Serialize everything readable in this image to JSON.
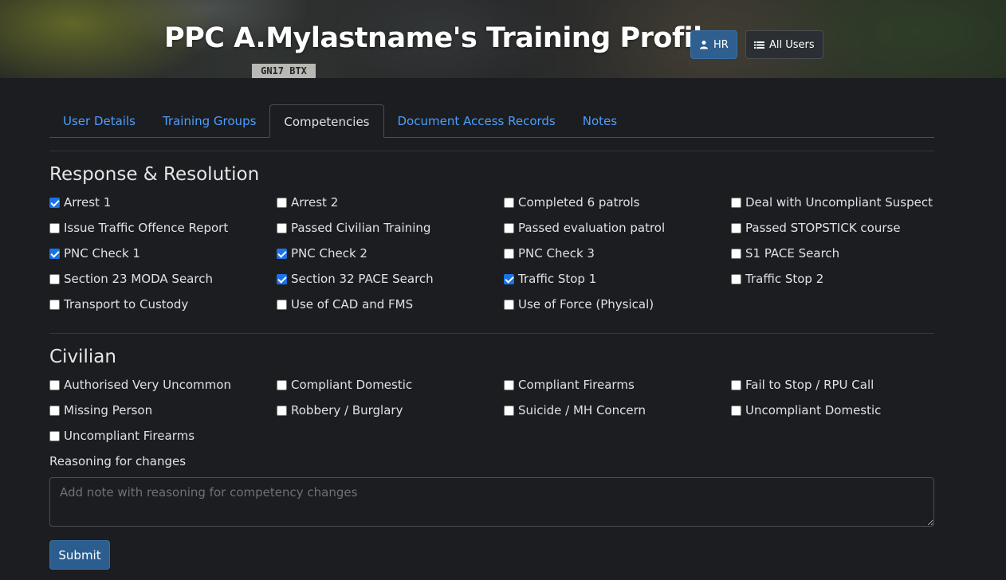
{
  "header": {
    "title": "PPC A.Mylastname's Training Profile",
    "plate_text": "GN17 BTX",
    "hr_label": "HR",
    "users_label": "All Users"
  },
  "tabs": [
    {
      "label": "User Details",
      "active": false
    },
    {
      "label": "Training Groups",
      "active": false
    },
    {
      "label": "Competencies",
      "active": true
    },
    {
      "label": "Document Access Records",
      "active": false
    },
    {
      "label": "Notes",
      "active": false
    }
  ],
  "sections": [
    {
      "title": "Response & Resolution",
      "items": [
        {
          "label": "Arrest 1",
          "checked": true
        },
        {
          "label": "Arrest 2",
          "checked": false
        },
        {
          "label": "Completed 6 patrols",
          "checked": false
        },
        {
          "label": "Deal with Uncompliant Suspect",
          "checked": false
        },
        {
          "label": "Issue Traffic Offence Report",
          "checked": false
        },
        {
          "label": "Passed Civilian Training",
          "checked": false
        },
        {
          "label": "Passed evaluation patrol",
          "checked": false
        },
        {
          "label": "Passed STOPSTICK course",
          "checked": false
        },
        {
          "label": "PNC Check 1",
          "checked": true
        },
        {
          "label": "PNC Check 2",
          "checked": true
        },
        {
          "label": "PNC Check 3",
          "checked": false
        },
        {
          "label": "S1 PACE Search",
          "checked": false
        },
        {
          "label": "Section 23 MODA Search",
          "checked": false
        },
        {
          "label": "Section 32 PACE Search",
          "checked": true
        },
        {
          "label": "Traffic Stop 1",
          "checked": true
        },
        {
          "label": "Traffic Stop 2",
          "checked": false
        },
        {
          "label": "Transport to Custody",
          "checked": false
        },
        {
          "label": "Use of CAD and FMS",
          "checked": false
        },
        {
          "label": "Use of Force (Physical)",
          "checked": false
        }
      ]
    },
    {
      "title": "Civilian",
      "items": [
        {
          "label": "Authorised Very Uncommon",
          "checked": false
        },
        {
          "label": "Compliant Domestic",
          "checked": false
        },
        {
          "label": "Compliant Firearms",
          "checked": false
        },
        {
          "label": "Fail to Stop / RPU Call",
          "checked": false
        },
        {
          "label": "Missing Person",
          "checked": false
        },
        {
          "label": "Robbery / Burglary",
          "checked": false
        },
        {
          "label": "Suicide / MH Concern",
          "checked": false
        },
        {
          "label": "Uncompliant Domestic",
          "checked": false
        },
        {
          "label": "Uncompliant Firearms",
          "checked": false
        }
      ]
    }
  ],
  "reason": {
    "label": "Reasoning for changes",
    "placeholder": "Add note with reasoning for competency changes",
    "value": ""
  },
  "submit_label": "Submit",
  "colors": {
    "accent": "#2c5d8f",
    "link": "#4d9eff",
    "background": "#1b1d20",
    "checkbox_checked": "#1a73e8"
  }
}
